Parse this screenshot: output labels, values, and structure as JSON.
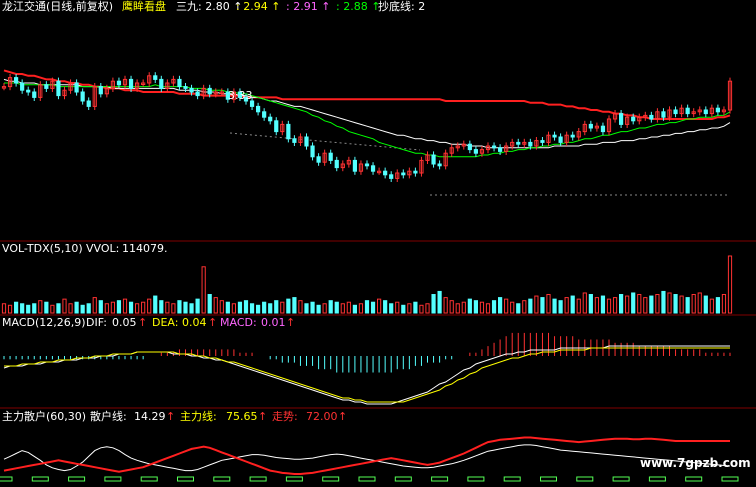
{
  "header": {
    "title": "龙江交通(日线,前复权)",
    "indicator_name": "鹰眸看盘",
    "items": [
      {
        "label": "三九:",
        "value": "2.80",
        "arrow": "↑",
        "color": "#ffffff"
      },
      {
        "label": ":",
        "value": "2.94",
        "arrow": "↑",
        "color": "#ffff00"
      },
      {
        "label": ":",
        "value": "2.91",
        "arrow": "↑",
        "color": "#ff66ff"
      },
      {
        "label": ":",
        "value": "2.88",
        "arrow": "↑",
        "color": "#00ff00"
      }
    ],
    "tail_label": "抄底线: 2"
  },
  "annotations": {
    "high_marker": "3.33"
  },
  "volume_panel": {
    "title": "VOL-TDX(5,10)",
    "value_label": "VVOL:",
    "value": "114079."
  },
  "macd_panel": {
    "title": "MACD(12,26,9)",
    "dif_label": "DIF:",
    "dif": "0.05",
    "dea_label": "DEA:",
    "dea": "0.04",
    "macd_label": "MACD:",
    "macd": "0.01",
    "arrow": "↑"
  },
  "zhuli_panel": {
    "title": "主力散户(60,30)",
    "sanhu_label": "散户线:",
    "sanhu": "14.29",
    "zhuli_label": "主力线:",
    "zhuli": "75.65",
    "trend_label": "走势:",
    "trend": "72.00",
    "arrow": "↑"
  },
  "watermark": "www.7gpzb.com",
  "colors": {
    "up": "#ff3232",
    "down": "#54ffff",
    "ma_white": "#ffffff",
    "ma_yellow": "#ffff00",
    "ma_magenta": "#ff66ff",
    "ma_green": "#00ff00",
    "ma_red": "#ff2020",
    "macd_pos": "#ff3232",
    "macd_neg": "#54ffff",
    "dif": "#ffffff",
    "dea": "#ffff00",
    "label_white": "#ffffff",
    "label_red": "#ff3232",
    "label_magenta": "#ff66ff"
  },
  "chart_data": {
    "type": "candlestick",
    "price_range": [
      2.3,
      3.5
    ],
    "close": [
      3.13,
      3.18,
      3.15,
      3.11,
      3.1,
      3.07,
      3.14,
      3.12,
      3.16,
      3.08,
      3.11,
      3.15,
      3.1,
      3.05,
      3.02,
      3.13,
      3.09,
      3.12,
      3.16,
      3.14,
      3.17,
      3.12,
      3.15,
      3.15,
      3.19,
      3.17,
      3.12,
      3.15,
      3.17,
      3.13,
      3.12,
      3.1,
      3.08,
      3.12,
      3.09,
      3.1,
      3.1,
      3.06,
      3.1,
      3.07,
      3.05,
      3.02,
      2.99,
      2.96,
      2.94,
      2.88,
      2.92,
      2.84,
      2.82,
      2.85,
      2.8,
      2.74,
      2.71,
      2.76,
      2.72,
      2.68,
      2.7,
      2.72,
      2.66,
      2.7,
      2.69,
      2.66,
      2.66,
      2.64,
      2.62,
      2.65,
      2.64,
      2.66,
      2.65,
      2.72,
      2.75,
      2.7,
      2.69,
      2.76,
      2.79,
      2.8,
      2.81,
      2.78,
      2.76,
      2.78,
      2.8,
      2.79,
      2.77,
      2.8,
      2.82,
      2.81,
      2.82,
      2.8,
      2.83,
      2.82,
      2.86,
      2.85,
      2.82,
      2.86,
      2.85,
      2.88,
      2.92,
      2.9,
      2.91,
      2.88,
      2.95,
      2.98,
      2.92,
      2.96,
      2.94,
      2.96,
      2.97,
      2.95,
      2.99,
      2.96,
      3.0,
      2.98,
      3.01,
      2.98,
      2.99,
      3.0,
      2.98,
      3.01,
      2.99,
      3.0,
      3.16
    ],
    "ma_red": [
      3.22,
      3.21,
      3.2,
      3.2,
      3.19,
      3.19,
      3.18,
      3.17,
      3.17,
      3.16,
      3.16,
      3.15,
      3.15,
      3.14,
      3.14,
      3.13,
      3.13,
      3.12,
      3.12,
      3.12,
      3.11,
      3.11,
      3.11,
      3.1,
      3.1,
      3.1,
      3.1,
      3.1,
      3.1,
      3.09,
      3.09,
      3.09,
      3.09,
      3.08,
      3.08,
      3.08,
      3.08,
      3.08,
      3.08,
      3.08,
      3.07,
      3.07,
      3.07,
      3.07,
      3.07,
      3.07,
      3.06,
      3.06,
      3.06,
      3.06,
      3.06,
      3.06,
      3.06,
      3.06,
      3.06,
      3.06,
      3.06,
      3.06,
      3.06,
      3.06,
      3.06,
      3.06,
      3.06,
      3.06,
      3.06,
      3.06,
      3.06,
      3.06,
      3.06,
      3.06,
      3.06,
      3.06,
      3.06,
      3.05,
      3.05,
      3.05,
      3.05,
      3.05,
      3.05,
      3.05,
      3.05,
      3.05,
      3.05,
      3.05,
      3.05,
      3.05,
      3.05,
      3.04,
      3.04,
      3.04,
      3.03,
      3.03,
      3.03,
      3.02,
      3.02,
      3.01,
      3.01,
      3.0,
      3.0,
      2.99,
      2.99,
      2.98,
      2.98,
      2.97,
      2.97,
      2.96,
      2.96,
      2.95,
      2.95,
      2.95,
      2.95,
      2.95,
      2.95,
      2.95,
      2.95,
      2.95,
      2.95,
      2.95,
      2.96,
      2.96,
      2.97
    ],
    "ma_white": [
      3.17,
      3.16,
      3.16,
      3.15,
      3.15,
      3.15,
      3.14,
      3.14,
      3.14,
      3.14,
      3.14,
      3.14,
      3.14,
      3.13,
      3.13,
      3.13,
      3.13,
      3.13,
      3.12,
      3.12,
      3.12,
      3.12,
      3.12,
      3.12,
      3.12,
      3.12,
      3.12,
      3.12,
      3.12,
      3.11,
      3.11,
      3.11,
      3.11,
      3.1,
      3.1,
      3.1,
      3.09,
      3.09,
      3.09,
      3.08,
      3.08,
      3.07,
      3.07,
      3.06,
      3.05,
      3.05,
      3.04,
      3.03,
      3.02,
      3.02,
      3.01,
      3.0,
      2.99,
      2.98,
      2.97,
      2.96,
      2.95,
      2.94,
      2.93,
      2.92,
      2.91,
      2.9,
      2.89,
      2.88,
      2.87,
      2.86,
      2.86,
      2.85,
      2.84,
      2.84,
      2.83,
      2.83,
      2.82,
      2.82,
      2.81,
      2.81,
      2.81,
      2.8,
      2.8,
      2.8,
      2.79,
      2.79,
      2.79,
      2.79,
      2.79,
      2.79,
      2.79,
      2.79,
      2.79,
      2.79,
      2.79,
      2.8,
      2.8,
      2.8,
      2.8,
      2.8,
      2.81,
      2.81,
      2.81,
      2.82,
      2.82,
      2.82,
      2.83,
      2.83,
      2.83,
      2.84,
      2.84,
      2.85,
      2.85,
      2.86,
      2.86,
      2.87,
      2.87,
      2.88,
      2.88,
      2.89,
      2.89,
      2.9,
      2.9,
      2.91,
      2.93
    ],
    "ma_green": [
      3.15,
      3.15,
      3.15,
      3.14,
      3.14,
      3.14,
      3.14,
      3.14,
      3.14,
      3.13,
      3.13,
      3.13,
      3.13,
      3.13,
      3.13,
      3.13,
      3.13,
      3.13,
      3.13,
      3.13,
      3.13,
      3.13,
      3.13,
      3.13,
      3.13,
      3.14,
      3.13,
      3.13,
      3.13,
      3.13,
      3.13,
      3.12,
      3.12,
      3.12,
      3.11,
      3.11,
      3.11,
      3.1,
      3.1,
      3.09,
      3.09,
      3.08,
      3.07,
      3.06,
      3.05,
      3.04,
      3.03,
      3.02,
      3.01,
      3.0,
      2.99,
      2.97,
      2.96,
      2.94,
      2.93,
      2.91,
      2.9,
      2.88,
      2.87,
      2.86,
      2.85,
      2.84,
      2.82,
      2.81,
      2.8,
      2.79,
      2.78,
      2.77,
      2.76,
      2.76,
      2.75,
      2.75,
      2.74,
      2.74,
      2.74,
      2.74,
      2.74,
      2.74,
      2.74,
      2.75,
      2.75,
      2.76,
      2.76,
      2.77,
      2.77,
      2.78,
      2.78,
      2.79,
      2.79,
      2.8,
      2.8,
      2.81,
      2.81,
      2.82,
      2.82,
      2.83,
      2.84,
      2.84,
      2.85,
      2.86,
      2.86,
      2.87,
      2.88,
      2.88,
      2.89,
      2.9,
      2.9,
      2.91,
      2.92,
      2.92,
      2.93,
      2.93,
      2.94,
      2.95,
      2.95,
      2.96,
      2.96,
      2.96,
      2.97,
      2.97,
      2.99
    ],
    "volume": [
      6,
      5,
      7,
      6,
      5,
      6,
      8,
      7,
      5,
      6,
      9,
      6,
      7,
      5,
      6,
      10,
      8,
      6,
      7,
      8,
      9,
      7,
      6,
      7,
      9,
      11,
      8,
      7,
      6,
      8,
      7,
      6,
      9,
      30,
      12,
      10,
      8,
      7,
      6,
      7,
      8,
      6,
      5,
      7,
      6,
      8,
      7,
      9,
      10,
      8,
      6,
      7,
      5,
      6,
      8,
      7,
      6,
      7,
      5,
      6,
      8,
      7,
      9,
      8,
      6,
      7,
      5,
      6,
      7,
      5,
      6,
      12,
      14,
      10,
      8,
      6,
      7,
      9,
      8,
      7,
      6,
      8,
      10,
      9,
      7,
      6,
      8,
      9,
      11,
      10,
      12,
      9,
      8,
      10,
      11,
      9,
      13,
      12,
      10,
      11,
      9,
      10,
      12,
      11,
      13,
      12,
      10,
      11,
      12,
      14,
      13,
      12,
      11,
      10,
      12,
      13,
      11,
      9,
      10,
      12,
      37
    ],
    "macd": [
      -0.01,
      -0.01,
      -0.01,
      -0.01,
      -0.01,
      -0.01,
      -0.01,
      -0.01,
      -0.01,
      -0.01,
      -0.01,
      -0.01,
      -0.01,
      -0.01,
      -0.01,
      -0.01,
      -0.01,
      -0.01,
      -0.01,
      -0.01,
      -0.01,
      -0.01,
      -0.01,
      -0.01,
      0.0,
      0.0,
      0.01,
      0.01,
      0.01,
      0.02,
      0.02,
      0.02,
      0.02,
      0.02,
      0.02,
      0.02,
      0.02,
      0.02,
      0.02,
      0.01,
      0.01,
      0.01,
      0.0,
      0.0,
      -0.01,
      -0.01,
      -0.02,
      -0.02,
      -0.02,
      -0.03,
      -0.03,
      -0.03,
      -0.04,
      -0.04,
      -0.04,
      -0.05,
      -0.05,
      -0.05,
      -0.05,
      -0.05,
      -0.05,
      -0.05,
      -0.05,
      -0.05,
      -0.05,
      -0.04,
      -0.04,
      -0.04,
      -0.03,
      -0.03,
      -0.02,
      -0.02,
      -0.02,
      -0.01,
      -0.01,
      0.0,
      0.0,
      0.01,
      0.01,
      0.02,
      0.03,
      0.04,
      0.05,
      0.06,
      0.07,
      0.07,
      0.07,
      0.07,
      0.07,
      0.07,
      0.07,
      0.06,
      0.06,
      0.06,
      0.06,
      0.05,
      0.05,
      0.05,
      0.05,
      0.05,
      0.05,
      0.04,
      0.04,
      0.04,
      0.04,
      0.03,
      0.03,
      0.03,
      0.03,
      0.03,
      0.03,
      0.02,
      0.02,
      0.02,
      0.02,
      0.02,
      0.01,
      0.01,
      0.01,
      0.01,
      0.01
    ],
    "dif": [
      -0.06,
      -0.05,
      -0.05,
      -0.05,
      -0.04,
      -0.04,
      -0.04,
      -0.03,
      -0.03,
      -0.03,
      -0.02,
      -0.02,
      -0.02,
      -0.01,
      -0.01,
      -0.01,
      0.0,
      0.0,
      0.0,
      0.01,
      0.01,
      0.01,
      0.02,
      0.02,
      0.02,
      0.02,
      0.02,
      0.02,
      0.01,
      0.01,
      0.01,
      0.0,
      0.0,
      -0.01,
      -0.01,
      -0.02,
      -0.02,
      -0.03,
      -0.04,
      -0.05,
      -0.06,
      -0.07,
      -0.08,
      -0.09,
      -0.1,
      -0.11,
      -0.12,
      -0.13,
      -0.14,
      -0.15,
      -0.16,
      -0.17,
      -0.18,
      -0.19,
      -0.2,
      -0.21,
      -0.22,
      -0.22,
      -0.23,
      -0.23,
      -0.24,
      -0.24,
      -0.24,
      -0.24,
      -0.24,
      -0.23,
      -0.22,
      -0.21,
      -0.2,
      -0.19,
      -0.18,
      -0.16,
      -0.14,
      -0.13,
      -0.11,
      -0.09,
      -0.07,
      -0.06,
      -0.04,
      -0.03,
      -0.02,
      -0.01,
      0.0,
      0.01,
      0.01,
      0.02,
      0.02,
      0.03,
      0.03,
      0.03,
      0.03,
      0.03,
      0.04,
      0.04,
      0.04,
      0.04,
      0.04,
      0.04,
      0.04,
      0.04,
      0.05,
      0.05,
      0.05,
      0.05,
      0.05,
      0.05,
      0.05,
      0.05,
      0.05,
      0.05,
      0.05,
      0.05,
      0.05,
      0.05,
      0.05,
      0.05,
      0.05,
      0.05,
      0.05,
      0.05,
      0.05
    ],
    "dea": [
      -0.05,
      -0.05,
      -0.05,
      -0.04,
      -0.04,
      -0.04,
      -0.03,
      -0.03,
      -0.03,
      -0.02,
      -0.02,
      -0.02,
      -0.01,
      -0.01,
      -0.01,
      0.0,
      0.0,
      0.0,
      0.01,
      0.01,
      0.01,
      0.01,
      0.02,
      0.02,
      0.02,
      0.02,
      0.02,
      0.02,
      0.02,
      0.01,
      0.01,
      0.01,
      0.0,
      0.0,
      -0.01,
      -0.01,
      -0.02,
      -0.03,
      -0.03,
      -0.04,
      -0.05,
      -0.06,
      -0.07,
      -0.08,
      -0.09,
      -0.1,
      -0.11,
      -0.12,
      -0.13,
      -0.14,
      -0.15,
      -0.16,
      -0.17,
      -0.18,
      -0.19,
      -0.2,
      -0.21,
      -0.21,
      -0.22,
      -0.22,
      -0.23,
      -0.23,
      -0.23,
      -0.23,
      -0.23,
      -0.23,
      -0.23,
      -0.22,
      -0.21,
      -0.2,
      -0.19,
      -0.18,
      -0.17,
      -0.15,
      -0.14,
      -0.12,
      -0.11,
      -0.09,
      -0.08,
      -0.06,
      -0.05,
      -0.04,
      -0.03,
      -0.02,
      -0.01,
      -0.01,
      0.0,
      0.01,
      0.01,
      0.02,
      0.02,
      0.02,
      0.03,
      0.03,
      0.03,
      0.03,
      0.03,
      0.04,
      0.04,
      0.04,
      0.04,
      0.04,
      0.04,
      0.04,
      0.04,
      0.04,
      0.04,
      0.04,
      0.04,
      0.04,
      0.04,
      0.04,
      0.04,
      0.04,
      0.04,
      0.04,
      0.04,
      0.04,
      0.04,
      0.04,
      0.04
    ],
    "sanhu_line": [
      40,
      45,
      50,
      55,
      52,
      45,
      38,
      30,
      25,
      22,
      20,
      22,
      28,
      35,
      45,
      55,
      60,
      62,
      60,
      55,
      48,
      42,
      38,
      35,
      32,
      30,
      28,
      26,
      24,
      22,
      20,
      20,
      22,
      26,
      30,
      34,
      38,
      40,
      42,
      44,
      46,
      48,
      48,
      47,
      45,
      43,
      42,
      41,
      40,
      40,
      41,
      42,
      44,
      46,
      48,
      49,
      48,
      46,
      44,
      42,
      40,
      38,
      36,
      34,
      32,
      30,
      28,
      27,
      26,
      25,
      25,
      26,
      28,
      30,
      32,
      35,
      38,
      42,
      46,
      50,
      54,
      56,
      58,
      60,
      62,
      64,
      65,
      65,
      64,
      62,
      60,
      58,
      56,
      55,
      54,
      53,
      52,
      51,
      50,
      49,
      48,
      47,
      46,
      45,
      44,
      43,
      42,
      41,
      40,
      39,
      38,
      37,
      36,
      35,
      34,
      33,
      32,
      31,
      30,
      29,
      28
    ],
    "zhuli_line": [
      20,
      22,
      24,
      26,
      28,
      30,
      32,
      34,
      36,
      38,
      36,
      34,
      32,
      30,
      28,
      26,
      24,
      22,
      20,
      18,
      20,
      22,
      24,
      26,
      30,
      34,
      38,
      42,
      46,
      50,
      54,
      58,
      60,
      62,
      60,
      56,
      52,
      48,
      44,
      40,
      36,
      32,
      28,
      24,
      20,
      18,
      16,
      15,
      14,
      14,
      15,
      16,
      18,
      20,
      22,
      24,
      26,
      28,
      30,
      32,
      34,
      36,
      38,
      40,
      42,
      40,
      38,
      36,
      34,
      32,
      30,
      32,
      34,
      38,
      42,
      46,
      50,
      55,
      60,
      65,
      70,
      72,
      74,
      75,
      76,
      77,
      78,
      78,
      77,
      76,
      75,
      74,
      73,
      72,
      71,
      70,
      71,
      72,
      73,
      74,
      75,
      76,
      76,
      76,
      75,
      75,
      76,
      76,
      75,
      74,
      73,
      72,
      72,
      72,
      72,
      72,
      72,
      72,
      72,
      72,
      72
    ]
  }
}
